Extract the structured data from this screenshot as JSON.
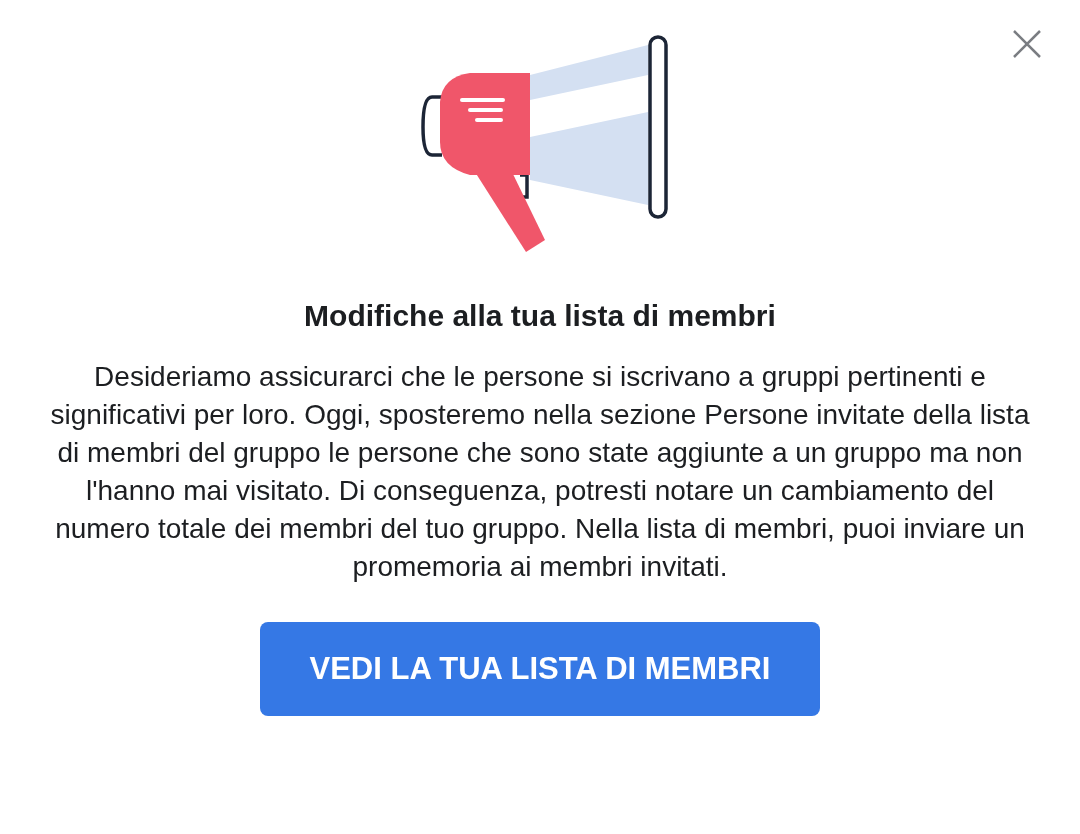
{
  "dialog": {
    "title": "Modifiche alla tua lista di membri",
    "body": "Desideriamo assicurarci che le persone si iscrivano a gruppi pertinenti e significativi per loro. Oggi, sposteremo nella sezione Persone invitate della lista di membri del gruppo le persone che sono state aggiunte a un gruppo ma non l'hanno mai visitato. Di conseguenza, potresti notare un cambiamento del numero totale dei membri del tuo gruppo. Nella lista di membri, puoi inviare un promemoria ai membri invitati.",
    "button": "VEDI LA TUA LISTA DI MEMBRI"
  }
}
